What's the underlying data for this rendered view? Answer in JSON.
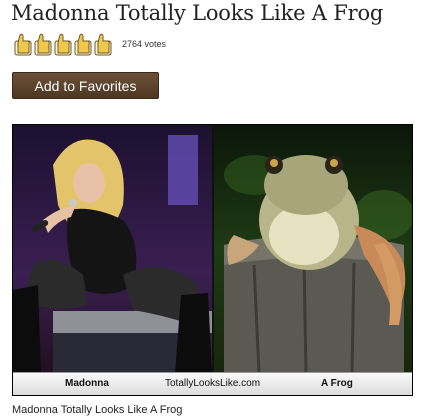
{
  "page": {
    "title": "Madonna Totally Looks Like A Frog",
    "bottom_link": "Madonna Totally Looks Like A Frog"
  },
  "rating": {
    "votes_label": "2764 votes",
    "thumbs": [
      {
        "icon": "thumbs-up-icon"
      },
      {
        "icon": "thumbs-up-icon"
      },
      {
        "icon": "thumbs-up-icon"
      },
      {
        "icon": "thumbs-up-icon"
      },
      {
        "icon": "thumbs-up-icon"
      }
    ]
  },
  "actions": {
    "add_favorites_label": "Add to Favorites"
  },
  "comparison": {
    "left_caption": "Madonna",
    "center_caption": "TotallyLooksLike.com",
    "right_caption": "A Frog"
  },
  "colors": {
    "button_brown": "#5a412a",
    "thumb_gold": "#f2c84b"
  }
}
